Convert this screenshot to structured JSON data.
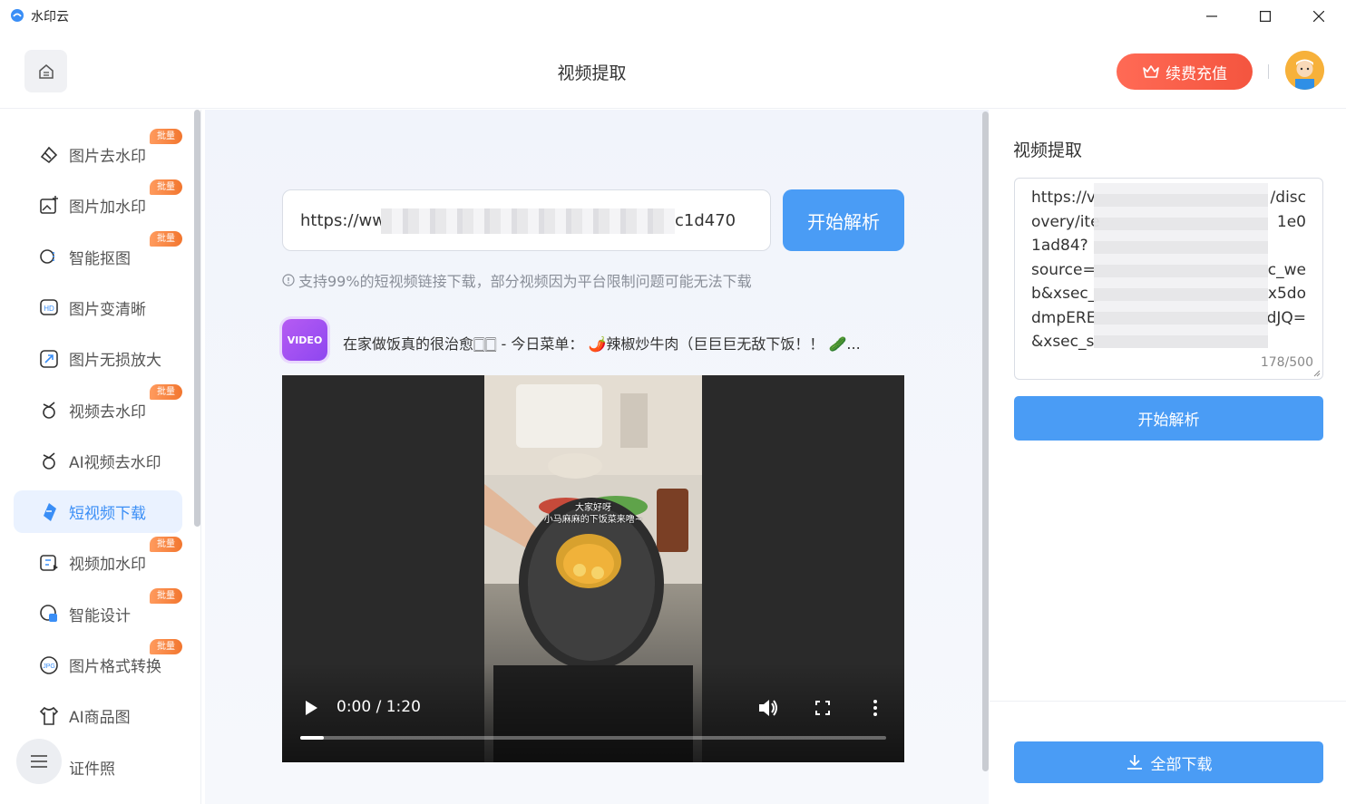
{
  "window": {
    "title": "水印云"
  },
  "header": {
    "title": "视频提取",
    "vip_label": "续费充值"
  },
  "sidebar": {
    "badge": "批量",
    "items": [
      {
        "label": "图片去水印",
        "badge": true,
        "icon": "eraser-icon"
      },
      {
        "label": "图片加水印",
        "badge": true,
        "icon": "image-add-icon"
      },
      {
        "label": "智能抠图",
        "badge": true,
        "icon": "cutout-icon"
      },
      {
        "label": "图片变清晰",
        "badge": false,
        "icon": "hd-icon"
      },
      {
        "label": "图片无损放大",
        "badge": false,
        "icon": "enlarge-icon"
      },
      {
        "label": "视频去水印",
        "badge": true,
        "icon": "video-clean-icon"
      },
      {
        "label": "AI视频去水印",
        "badge": false,
        "icon": "ai-video-clean-icon"
      },
      {
        "label": "短视频下载",
        "badge": false,
        "icon": "download-icon",
        "active": true
      },
      {
        "label": "视频加水印",
        "badge": true,
        "icon": "video-add-icon"
      },
      {
        "label": "智能设计",
        "badge": true,
        "icon": "design-icon"
      },
      {
        "label": "图片格式转换",
        "badge": true,
        "icon": "jpg-convert-icon"
      },
      {
        "label": "AI商品图",
        "badge": false,
        "icon": "tshirt-icon"
      },
      {
        "label": "证件照",
        "badge": false,
        "icon": "id-photo-icon"
      }
    ]
  },
  "main": {
    "url_prefix": "https://ww",
    "url_suffix": "c1d470",
    "parse_label": "开始解析",
    "hint": "支持99%的短视频链接下载，部分视频因为平台限制问题可能无法下载",
    "video_badge": "VIDEO",
    "video_title": "在家做饭真的很治愈🀆🀆 - 今日菜单： 🌶️辣椒炒牛肉（巨巨巨无敌下饭！！ 🥒...",
    "subtitle_line1": "大家好呀",
    "subtitle_line2": "小马麻麻的下饭菜来噜~",
    "player": {
      "time": "0:00 / 1:20",
      "progress": 0.04
    }
  },
  "right_panel": {
    "title": "视频提取",
    "textarea_lines": [
      {
        "left": "https://v",
        "right": "/disc"
      },
      {
        "left": "overy/ite",
        "right": "1e0"
      },
      {
        "left": "1ad84?",
        "right": ""
      },
      {
        "left": "source=",
        "right": "c_we"
      },
      {
        "left": "b&xsec_",
        "right": "x5do"
      },
      {
        "left": "dmpERE",
        "right": "dJQ="
      },
      {
        "left": "&xsec_s",
        "right": ""
      }
    ],
    "count": "178/500",
    "parse_label": "开始解析",
    "download_label": "全部下载"
  },
  "colors": {
    "accent": "#4a9cf5",
    "vip": "#f4553f",
    "badge": "#f2762f",
    "active_bg": "#eaf2ff"
  }
}
